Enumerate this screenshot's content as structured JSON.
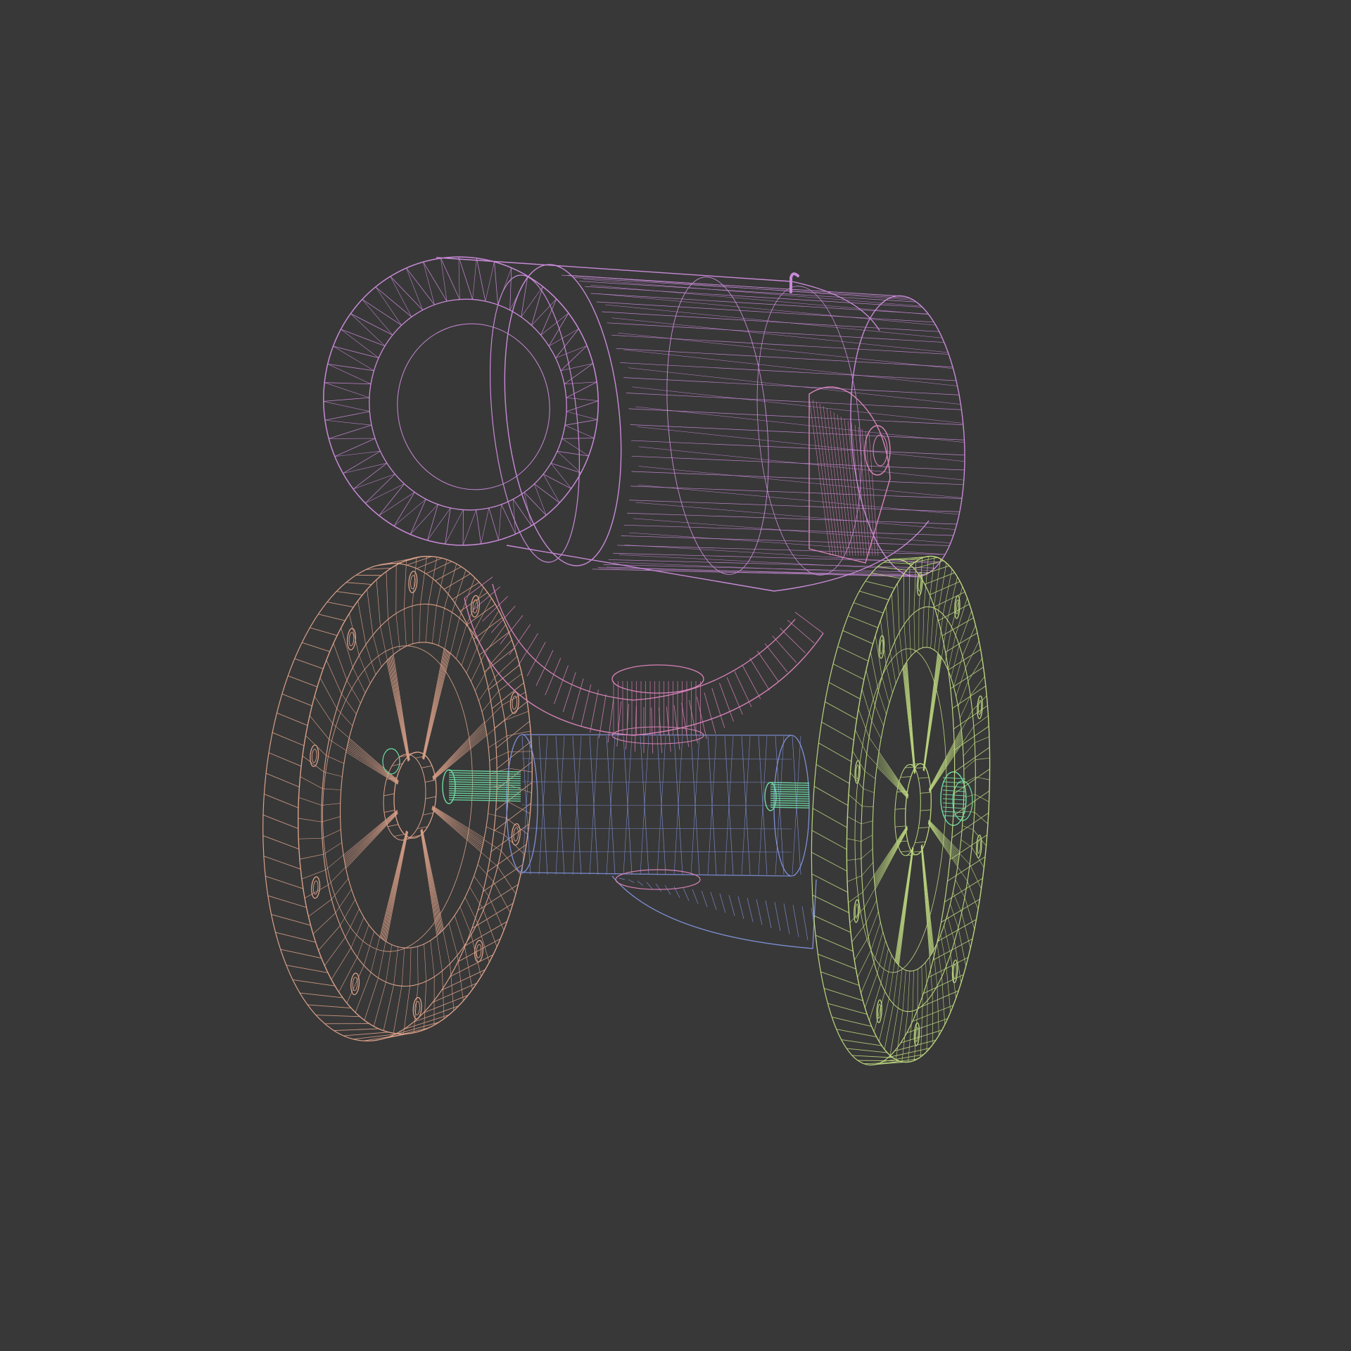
{
  "scene": {
    "background": "#383838",
    "render_style": "wireframe",
    "subject": "cannon",
    "objects": [
      {
        "id": "barrel",
        "color": "#c98ad8"
      },
      {
        "id": "barrel-ring-front",
        "color": "#c98ad8"
      },
      {
        "id": "trunnion-bracket",
        "color": "#d782b8"
      },
      {
        "id": "carriage-block",
        "color": "#7f90d8"
      },
      {
        "id": "axle",
        "color": "#6fdca4"
      },
      {
        "id": "left-wheel",
        "color": "#d9a088"
      },
      {
        "id": "right-wheel",
        "color": "#bcd67e"
      },
      {
        "id": "fuse-hook",
        "color": "#c98ad8"
      }
    ]
  }
}
